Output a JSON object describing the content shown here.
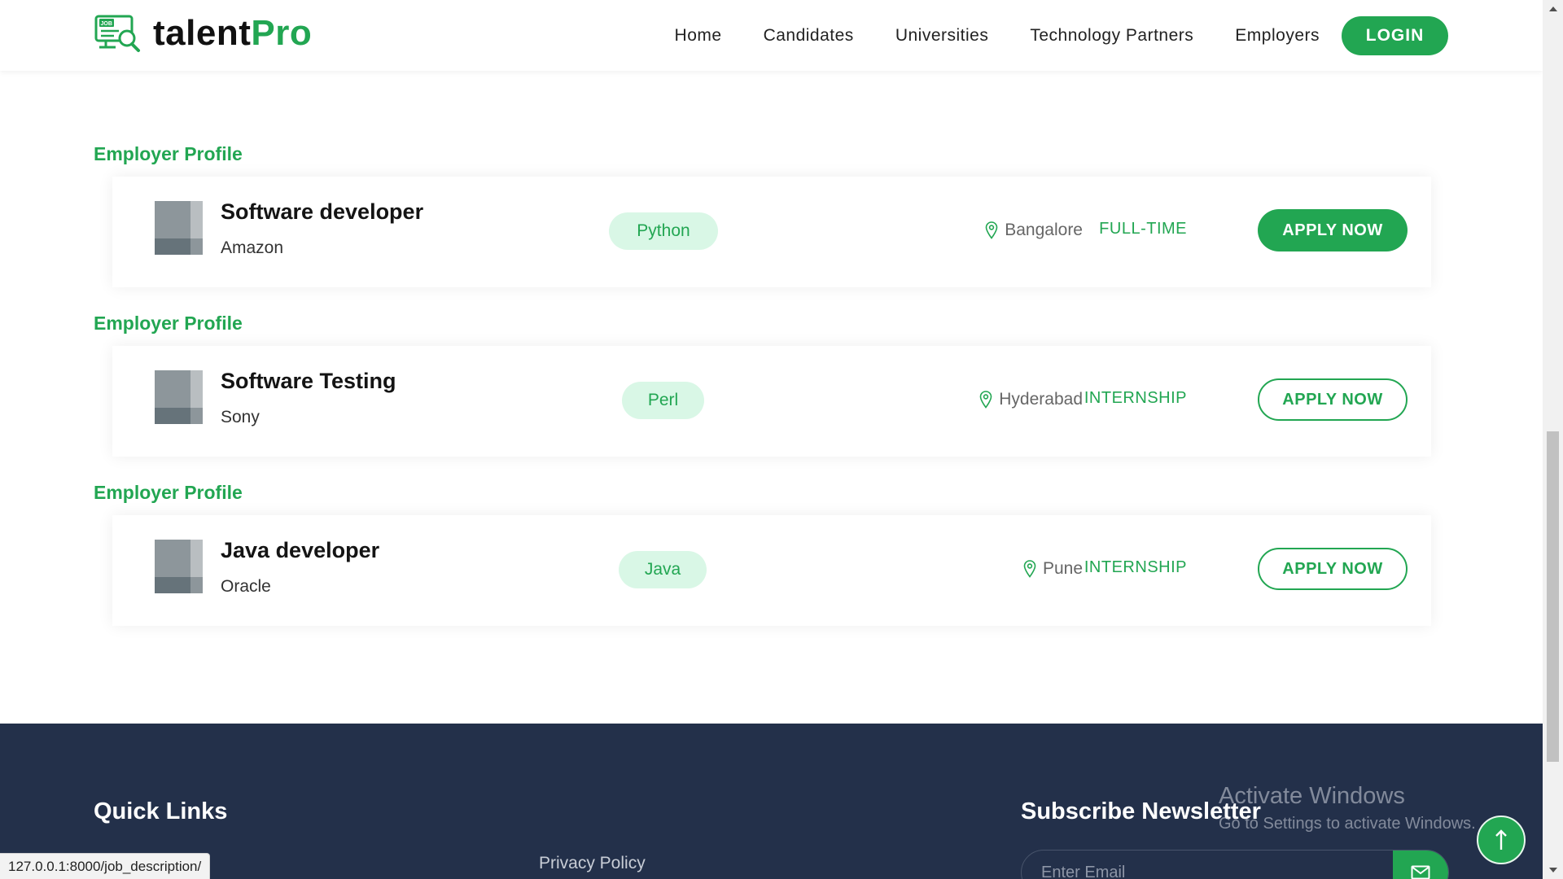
{
  "header": {
    "logo": {
      "badge_text": "JOB",
      "name_dark": "talent",
      "name_accent": "Pro"
    },
    "nav": [
      "Home",
      "Candidates",
      "Universities",
      "Technology Partners",
      "Employers"
    ],
    "login_label": "LOGIN"
  },
  "jobs": [
    {
      "section_label": "Employer Profile",
      "title": "Software developer",
      "company": "Amazon",
      "skill": "Python",
      "location": "Bangalore",
      "type": "FULL-TIME",
      "apply_label": "APPLY NOW",
      "apply_style": "filled"
    },
    {
      "section_label": "Employer Profile",
      "title": "Software Testing",
      "company": "Sony",
      "skill": "Perl",
      "location": "Hyderabad",
      "type": "INTERNSHIP",
      "apply_label": "APPLY NOW",
      "apply_style": "outline"
    },
    {
      "section_label": "Employer Profile",
      "title": "Java developer",
      "company": "Oracle",
      "skill": "Java",
      "location": "Pune",
      "type": "INTERNSHIP",
      "apply_label": "APPLY NOW",
      "apply_style": "outline"
    }
  ],
  "footer": {
    "quick_links_heading": "Quick Links",
    "privacy_policy": "Privacy Policy",
    "newsletter_heading": "Subscribe Newsletter",
    "email_placeholder": "Enter Email"
  },
  "watermark": {
    "title": "Activate Windows",
    "subtitle": "Go to Settings to activate Windows."
  },
  "status_url": "127.0.0.1:8000/job_description/",
  "colors": {
    "accent": "#22a652",
    "pill_bg": "#d9f7e6",
    "footer_bg": "#23304a"
  },
  "icons": [
    "job-search-logo-icon",
    "map-pin-icon",
    "envelope-icon",
    "arrow-up-icon",
    "scroll-up-arrow-icon",
    "scroll-down-arrow-icon"
  ]
}
